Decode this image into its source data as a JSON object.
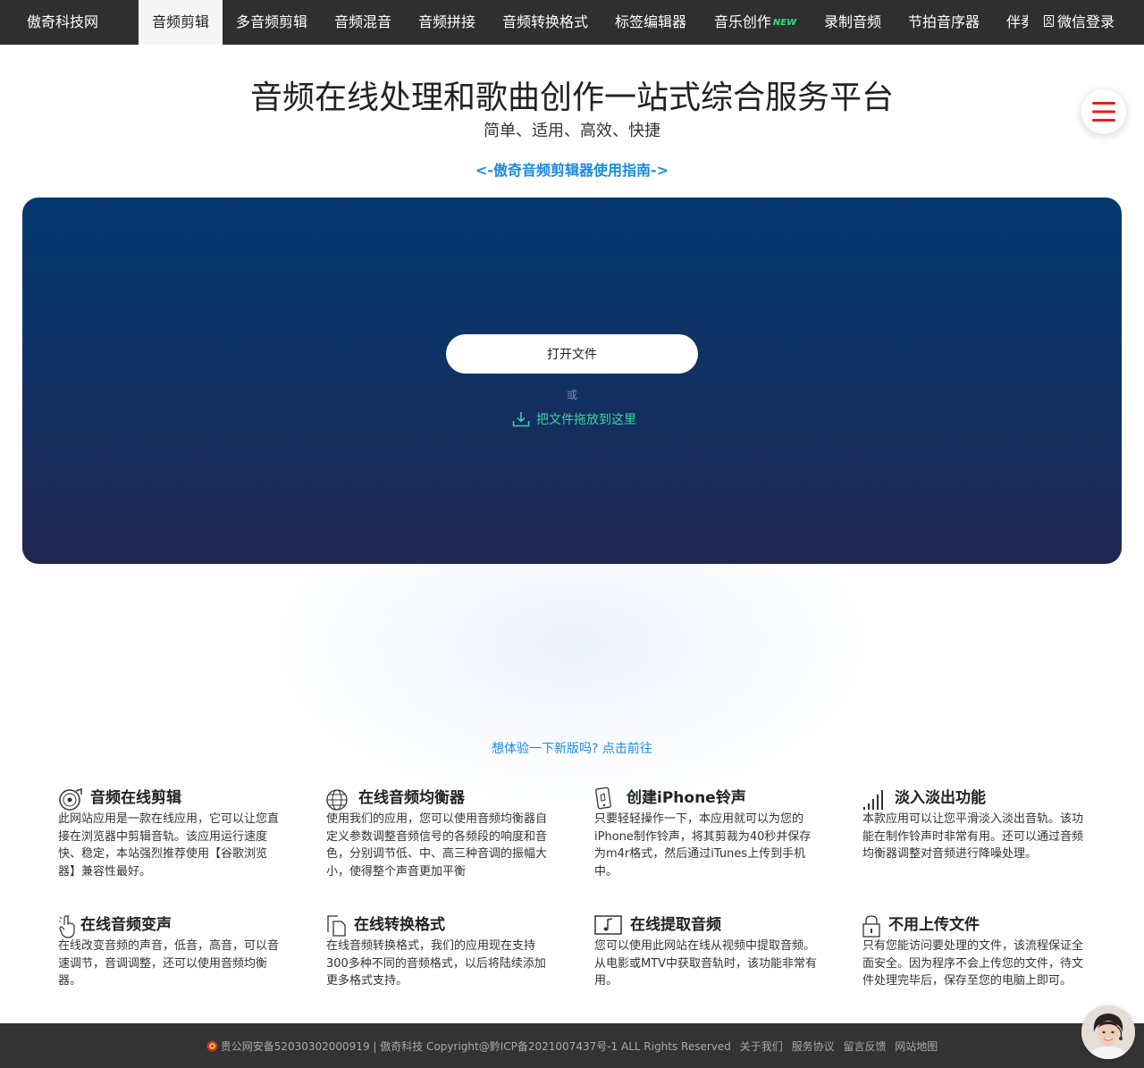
{
  "nav": {
    "brand": "傲奇科技网",
    "items": [
      {
        "label": "音频剪辑",
        "active": true
      },
      {
        "label": "多音频剪辑"
      },
      {
        "label": "音频混音"
      },
      {
        "label": "音频拼接"
      },
      {
        "label": "音频转换格式"
      },
      {
        "label": "标签编辑器"
      },
      {
        "label": "音乐创作",
        "badge": "NEW"
      },
      {
        "label": "录制音频"
      },
      {
        "label": "节拍音序器"
      },
      {
        "label": "伴奏"
      }
    ],
    "login": "微信登录"
  },
  "header": {
    "title": "音频在线处理和歌曲创作一站式综合服务平台",
    "subtitle": "简单、适用、高效、快捷",
    "guide_link": "<-傲奇音频剪辑器使用指南->"
  },
  "upload": {
    "open_button": "打开文件",
    "or": "或",
    "drop_text": "把文件拖放到这里"
  },
  "newversion_link": "想体验一下新版吗? 点击前往",
  "features": [
    {
      "title": "音频在线剪辑",
      "icon": "vinyl-record-icon",
      "desc": "此网站应用是一款在线应用，它可以让您直接在浏览器中剪辑音轨。该应用运行速度快、稳定，本站强烈推荐使用【谷歌浏览器】兼容性最好。"
    },
    {
      "title": "在线音频均衡器",
      "icon": "globe-icon",
      "desc": "使用我们的应用，您可以使用音频均衡器自定义参数调整音频信号的各频段的响度和音色，分别调节低、中、高三种音调的振幅大小，使得整个声音更加平衡"
    },
    {
      "title": "创建iPhone铃声",
      "icon": "phone-icon",
      "desc": "只要轻轻操作一下，本应用就可以为您的iPhone制作铃声，将其剪裁为40秒并保存为m4r格式，然后通过iTunes上传到手机中。"
    },
    {
      "title": "淡入淡出功能",
      "icon": "signal-bars-icon",
      "desc": "本款应用可以让您平滑淡入淡出音轨。该功能在制作铃声时非常有用。还可以通过音频均衡器调整对音频进行降噪处理。"
    },
    {
      "title": "在线音频变声",
      "icon": "hand-pointer-icon",
      "desc": "在线改变音频的声音，低音，高音，可以音速调节，音调调整，还可以使用音频均衡器。"
    },
    {
      "title": "在线转换格式",
      "icon": "copy-files-icon",
      "desc": "在线音频转换格式，我们的应用现在支持300多种不同的音频格式，以后将陆续添加更多格式支持。"
    },
    {
      "title": "在线提取音频",
      "icon": "music-note-icon",
      "desc": "您可以使用此网站在线从视频中提取音频。从电影或MTV中获取音轨时，该功能非常有用。"
    },
    {
      "title": "不用上传文件",
      "icon": "padlock-icon",
      "desc": "只有您能访问要处理的文件，该流程保证全面安全。因为程序不会上传您的文件，待文件处理完毕后，保存至您的电脑上即可。"
    }
  ],
  "footer": {
    "police": "贵公网安备52030302000919",
    "copyright": " | 傲奇科技 Copyright@黔ICP备2021007437号-1 ALL Rights Reserved",
    "links": [
      "关于我们",
      "服务协议",
      "留言反馈",
      "网站地图"
    ]
  },
  "colors": {
    "nav_bg": "#2f2f2f",
    "link_blue": "#1a8ae0",
    "drop_green": "#36d6a0",
    "menu_red": "#e0221c",
    "panel_top": "#05386f",
    "panel_bottom": "#202650"
  }
}
